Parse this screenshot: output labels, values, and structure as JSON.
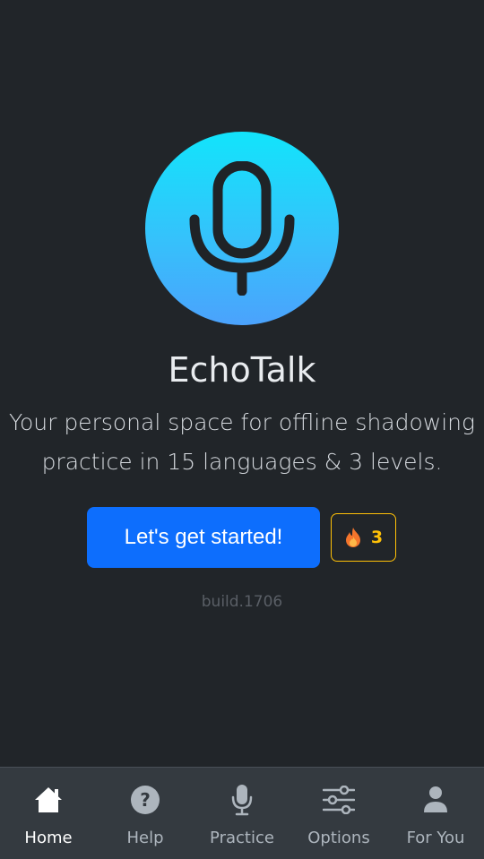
{
  "app": {
    "title": "EchoTalk",
    "tagline_line1": "Your personal space for offline shadowing",
    "tagline_line2": "practice in 15 languages & 3 levels."
  },
  "actions": {
    "start_label": "Let's get started!",
    "streak_count": "3"
  },
  "build": "build.1706",
  "nav": {
    "items": [
      {
        "label": "Home",
        "icon": "home-icon",
        "active": true
      },
      {
        "label": "Help",
        "icon": "help-icon",
        "active": false
      },
      {
        "label": "Practice",
        "icon": "microphone-icon",
        "active": false
      },
      {
        "label": "Options",
        "icon": "sliders-icon",
        "active": false
      },
      {
        "label": "For You",
        "icon": "person-icon",
        "active": false
      }
    ]
  },
  "colors": {
    "background": "#212529",
    "primary": "#0d6efd",
    "warning": "#ffc107",
    "nav_background": "#343a40"
  }
}
